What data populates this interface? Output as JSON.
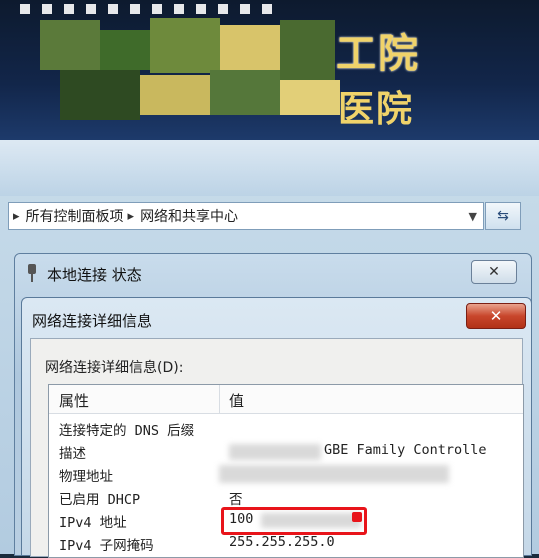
{
  "banner": {
    "line1": "工院",
    "line2": "医院"
  },
  "explorer": {
    "breadcrumb": [
      "所有控制面板项",
      "网络和共享中心"
    ]
  },
  "status_dialog": {
    "title": "本地连接 状态",
    "close": "✕"
  },
  "details_dialog": {
    "title": "网络连接详细信息",
    "close": "✕",
    "label": "网络连接详细信息(D):",
    "columns": {
      "property": "属性",
      "value": "值"
    },
    "rows": [
      {
        "property": "连接特定的 DNS 后缀",
        "value": ""
      },
      {
        "property": "描述",
        "value": "GBE Family Controlle"
      },
      {
        "property": "物理地址",
        "value": ""
      },
      {
        "property": "已启用 DHCP",
        "value": "否"
      },
      {
        "property": "IPv4 地址",
        "value": "100"
      },
      {
        "property": "IPv4 子网掩码",
        "value": "255.255.255.0"
      }
    ]
  },
  "colors": {
    "highlight": "#e8141a",
    "close_red": "#c8462c",
    "banner_gold": "#f0d36a"
  }
}
